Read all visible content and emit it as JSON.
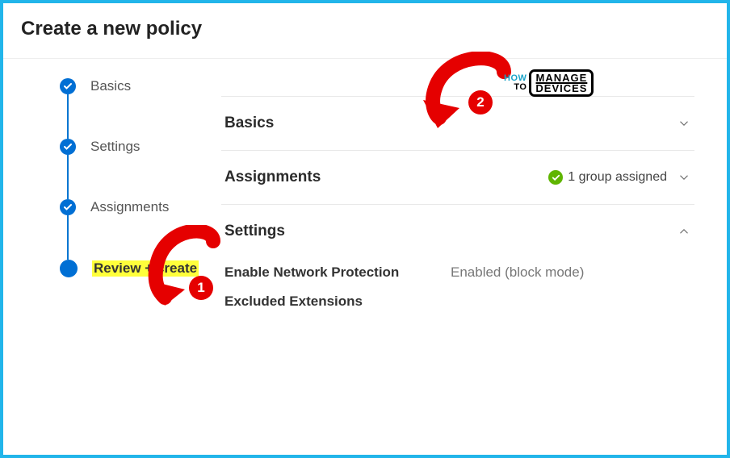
{
  "title": "Create a new policy",
  "stepper": {
    "steps": [
      {
        "label": "Basics",
        "state": "complete"
      },
      {
        "label": "Settings",
        "state": "complete"
      },
      {
        "label": "Assignments",
        "state": "complete"
      },
      {
        "label": "Review + create",
        "state": "active"
      }
    ]
  },
  "sections": {
    "basics": {
      "title": "Basics"
    },
    "assignments": {
      "title": "Assignments",
      "status": "1 group assigned"
    },
    "settings": {
      "title": "Settings",
      "rows": [
        {
          "key": "Enable Network Protection",
          "value": "Enabled (block mode)"
        },
        {
          "key": "Excluded Extensions",
          "value": ""
        }
      ]
    }
  },
  "annotations": {
    "badge1": "1",
    "badge2": "2"
  },
  "watermark": {
    "line1a": "HOW",
    "line1b": "TO",
    "line2a": "MANAGE",
    "line2b": "DEVICES"
  },
  "icons": {
    "check": "check-icon",
    "chevron_down": "chevron-down-icon",
    "chevron_up": "chevron-up-icon"
  }
}
